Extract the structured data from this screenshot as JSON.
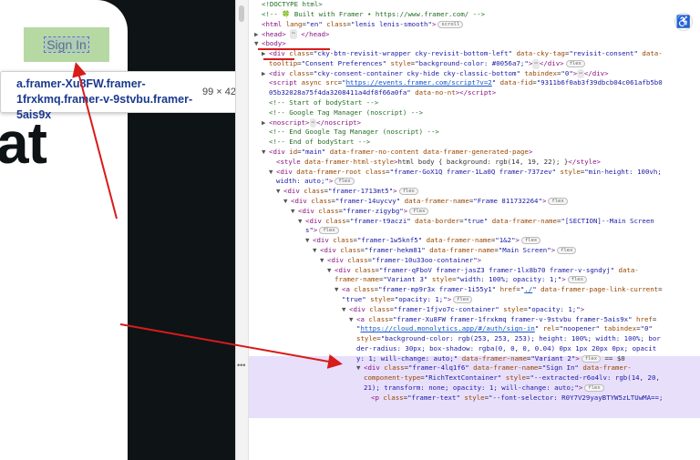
{
  "preview": {
    "signin_label": "Sign In",
    "big_word": "at"
  },
  "tooltip": {
    "selector": "a.framer-Xu8FW.framer-1frxkmq.framer-v-9stvbu.framer-5ais9x",
    "size": "99 × 42"
  },
  "devtools": {
    "lines": [
      {
        "indent": 0,
        "html": "<span class='cm'>&lt;!DOCTYPE html&gt;</span>"
      },
      {
        "indent": 0,
        "html": "<span class='cm'>&lt;!-- 🍀 Built with Framer • https://www.framer.com/ --&gt;</span>"
      },
      {
        "indent": 0,
        "html": "<span class='tg'>&lt;html</span> <span class='at'>lang</span>=<span class='av'>\"en\"</span> <span class='at'>class</span>=<span class='av'>\"lenis lenis-smooth\"</span><span class='tg'>&gt;</span><span class='pill'>scroll</span>"
      },
      {
        "indent": 0,
        "tri": "▶",
        "html": "<span class='tg'>&lt;head&gt;</span> <span class='ell'>⋯</span> <span class='tg'>&lt;/head&gt;</span>"
      },
      {
        "indent": 0,
        "tri": "▼",
        "html": "<span class='tg'>&lt;body&gt;</span>"
      },
      {
        "indent": 1,
        "tri": "▶",
        "html": "<span class='tg'>&lt;div</span> <span class='at'>class</span>=<span class='av'>\"cky-btn-revisit-wrapper cky-revisit-bottom-left\"</span> <span class='at'>data-cky-tag</span>=<span class='av'>\"revisit-consent\"</span> <span class='at'>data-</span>"
      },
      {
        "indent": 1,
        "html": "<span class='at'>tooltip</span>=<span class='av'>\"Consent Preferences\"</span> <span class='at'>style</span>=<span class='av'>\"background-color: #0056a7;\"</span><span class='tg'>&gt;</span><span class='ell'>⋯</span><span class='tg'>&lt;/div&gt;</span><span class='pill'>flex</span>"
      },
      {
        "indent": 1,
        "tri": "▶",
        "html": "<span class='tg'>&lt;div</span> <span class='at'>class</span>=<span class='av'>\"cky-consent-container cky-hide cky-classic-bottom\"</span> <span class='at'>tabindex</span>=<span class='av'>\"0\"</span><span class='tg'>&gt;</span><span class='ell'>⋯</span><span class='tg'>&lt;/div&gt;</span>"
      },
      {
        "indent": 1,
        "html": "<span class='tg'>&lt;script</span> <span class='at'>async</span> <span class='at'>src</span>=<span class='av'>\"</span><span class='lk'>https://events.framer.com/script?v=2</span><span class='av'>\"</span> <span class='at'>data-fid</span>=<span class='av'>\"9311b6f0ab3f39dbcb04c061afb5b0</span>"
      },
      {
        "indent": 1,
        "html": "<span class='av'>05b32028a75f4da3208411a4df8f66a0fa\"</span> <span class='at'>data-no-nt</span><span class='tg'>&gt;&lt;/script&gt;</span>"
      },
      {
        "indent": 1,
        "html": "<span class='cm'>&lt;!-- Start of bodyStart --&gt;</span>"
      },
      {
        "indent": 1,
        "html": "<span class='cm'>&lt;!-- Google Tag Manager (noscript) --&gt;</span>"
      },
      {
        "indent": 1,
        "tri": "▶",
        "html": "<span class='tg'>&lt;noscript&gt;</span><span class='ell'>⋯</span><span class='tg'>&lt;/noscript&gt;</span>"
      },
      {
        "indent": 1,
        "html": "<span class='cm'>&lt;!-- End Google Tag Manager (noscript) --&gt;</span>"
      },
      {
        "indent": 1,
        "html": "<span class='cm'>&lt;!-- End of bodyStart --&gt;</span>"
      },
      {
        "indent": 1,
        "tri": "▼",
        "html": "<span class='tg'>&lt;div</span> <span class='at'>id</span>=<span class='av'>\"main\"</span> <span class='at'>data-framer-no-content</span> <span class='at'>data-framer-generated-page</span><span class='tg'>&gt;</span>"
      },
      {
        "indent": 2,
        "html": "<span class='tg'>&lt;style</span> <span class='at'>data-framer-html-style</span><span class='tg'>&gt;</span>html body { background: rgb(14, 19, 22); }<span class='tg'>&lt;/style&gt;</span>"
      },
      {
        "indent": 2,
        "tri": "▼",
        "html": "<span class='tg'>&lt;div</span> <span class='at'>data-framer-root</span> <span class='at'>class</span>=<span class='av'>\"framer-GoX1Q framer-1La0Q framer-737zev\"</span> <span class='at'>style</span>=<span class='av'>\"min-height: 100vh;</span>"
      },
      {
        "indent": 2,
        "html": "<span class='av'>width: auto;\"</span><span class='tg'>&gt;</span><span class='pill'>flex</span>"
      },
      {
        "indent": 3,
        "tri": "▼",
        "html": "<span class='tg'>&lt;div</span> <span class='at'>class</span>=<span class='av'>\"framer-1713mt5\"</span><span class='tg'>&gt;</span><span class='pill'>flex</span>"
      },
      {
        "indent": 4,
        "tri": "▼",
        "html": "<span class='tg'>&lt;div</span> <span class='at'>class</span>=<span class='av'>\"framer-14uycvy\"</span> <span class='at'>data-framer-name</span>=<span class='av'>\"Frame 811732264\"</span><span class='tg'>&gt;</span><span class='pill'>flex</span>"
      },
      {
        "indent": 5,
        "tri": "▼",
        "html": "<span class='tg'>&lt;div</span> <span class='at'>class</span>=<span class='av'>\"framer-zigybg\"</span><span class='tg'>&gt;</span><span class='pill'>flex</span>"
      },
      {
        "indent": 6,
        "tri": "▼",
        "html": "<span class='tg'>&lt;div</span> <span class='at'>class</span>=<span class='av'>\"framer-t9aczi\"</span> <span class='at'>data-border</span>=<span class='av'>\"true\"</span> <span class='at'>data-framer-name</span>=<span class='av'>\"[SECTION]--Main Screen</span>"
      },
      {
        "indent": 6,
        "html": "<span class='av'>s\"</span><span class='tg'>&gt;</span><span class='pill'>flex</span>"
      },
      {
        "indent": 7,
        "tri": "▼",
        "html": "<span class='tg'>&lt;div</span> <span class='at'>class</span>=<span class='av'>\"framer-1w5knf5\"</span> <span class='at'>data-framer-name</span>=<span class='av'>\"1&amp;2\"</span><span class='tg'>&gt;</span><span class='pill'>flex</span>"
      },
      {
        "indent": 8,
        "tri": "▼",
        "html": "<span class='tg'>&lt;div</span> <span class='at'>class</span>=<span class='av'>\"framer-hekm81\"</span> <span class='at'>data-framer-name</span>=<span class='av'>\"Main Screen\"</span><span class='tg'>&gt;</span><span class='pill'>flex</span>"
      },
      {
        "indent": 9,
        "tri": "▼",
        "html": "<span class='tg'>&lt;div</span> <span class='at'>class</span>=<span class='av'>\"framer-10u33oo-container\"</span><span class='tg'>&gt;</span>"
      },
      {
        "indent": 10,
        "tri": "▼",
        "html": "<span class='tg'>&lt;div</span> <span class='at'>class</span>=<span class='av'>\"framer-qFboV framer-jasZ3 framer-1lx8b70 framer-v-sgndyj\"</span> <span class='at'>data-</span>"
      },
      {
        "indent": 10,
        "html": "<span class='at'>framer-name</span>=<span class='av'>\"Variant 3\"</span> <span class='at'>style</span>=<span class='av'>\"width: 100%; opacity: 1;\"</span><span class='tg'>&gt;</span><span class='pill'>flex</span>"
      },
      {
        "indent": 11,
        "tri": "▼",
        "html": "<span class='tg'>&lt;a</span> <span class='at'>class</span>=<span class='av'>\"framer-mp9r3x framer-1i55y1\"</span> <span class='at'>href</span>=<span class='av'>\"</span><span class='lk'>./</span><span class='av'>\"</span> <span class='at'>data-framer-page-link-current</span>="
      },
      {
        "indent": 11,
        "html": "<span class='av'>\"true\"</span> <span class='at'>style</span>=<span class='av'>\"opacity: 1;\"</span><span class='tg'>&gt;</span><span class='pill'>flex</span>"
      },
      {
        "indent": 12,
        "tri": "▼",
        "html": "<span class='tg'>&lt;div</span> <span class='at'>class</span>=<span class='av'>\"framer-1fjvo7c-container\"</span> <span class='at'>style</span>=<span class='av'>\"opacity: 1;\"</span><span class='tg'>&gt;</span>"
      },
      {
        "indent": 13,
        "tri": "▼",
        "html": "<span class='tg'>&lt;a</span> <span class='at'>class</span>=<span class='av'>\"framer-Xu8FW framer-1frxkmq framer-v-9stvbu framer-5ais9x\"</span> <span class='at'>href</span>="
      },
      {
        "indent": 13,
        "html": "<span class='av'>\"</span><span class='lk'>https://cloud.monolytics.app/#/auth/sign-in</span><span class='av'>\"</span> <span class='at'>rel</span>=<span class='av'>\"noopener\"</span> <span class='at'>tabindex</span>=<span class='av'>\"0\"</span>"
      },
      {
        "indent": 13,
        "html": "<span class='at'>style</span>=<span class='av'>\"background-color: rgb(253, 253, 253); height: 100%; width: 100%; bor</span>"
      },
      {
        "indent": 13,
        "html": "<span class='av'>der-radius: 30px; box-shadow: rgba(0, 0, 0, 0.04) 0px 1px 20px 0px; opacit</span>"
      },
      {
        "indent": 13,
        "html": "<span class='av'>y: 1; will-change: auto;\"</span> <span class='at'>data-framer-name</span>=<span class='av'>\"Variant 2\"</span><span class='tg'>&gt;</span><span class='pill'>flex</span> == $0"
      },
      {
        "indent": 14,
        "tri": "▼",
        "html": "<span class='tg'>&lt;div</span> <span class='at'>class</span>=<span class='av'>\"framer-4lq1f6\"</span> <span class='at'>data-framer-name</span>=<span class='av'>\"Sign In\"</span> <span class='at'>data-framer-</span>"
      },
      {
        "indent": 14,
        "html": "<span class='at'>component-type</span>=<span class='av'>\"RichTextContainer\"</span> <span class='at'>style</span>=<span class='av'>\"--extracted-r6o4lv: rgb(14, 20,</span>"
      },
      {
        "indent": 14,
        "html": "<span class='av'>21); transform: none; opacity: 1; will-change: auto;\"</span><span class='tg'>&gt;</span><span class='pill'>flex</span>"
      },
      {
        "indent": 15,
        "html": "<span class='tg'>&lt;p</span> <span class='at'>class</span>=<span class='av'>\"framer-text\"</span> <span class='at'>style</span>=<span class='av'>\"--font-selector: R0Y7V29yayBTYW5zLTUwMA==;</span>"
      }
    ]
  }
}
